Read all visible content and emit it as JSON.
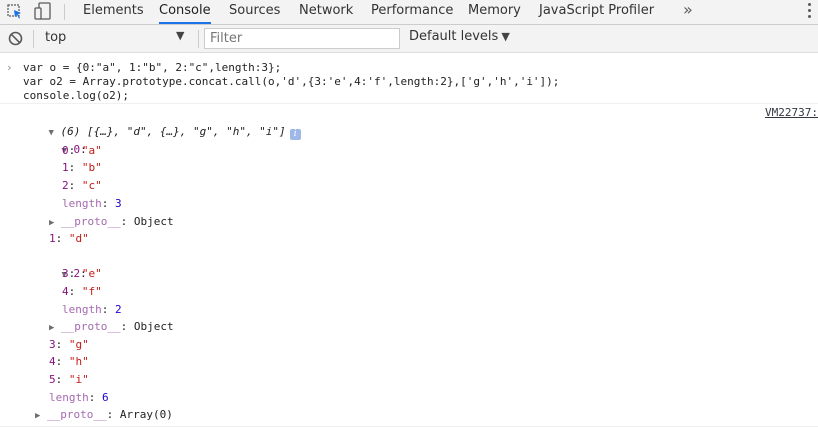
{
  "tabs": [
    {
      "label": "Elements"
    },
    {
      "label": "Console"
    },
    {
      "label": "Sources"
    },
    {
      "label": "Network"
    },
    {
      "label": "Performance"
    },
    {
      "label": "Memory"
    },
    {
      "label": "JavaScript Profiler"
    }
  ],
  "tab_more": "»",
  "toolbar": {
    "context": "top",
    "filter_placeholder": "Filter",
    "levels": "Default levels"
  },
  "input_code": [
    "var o = {0:\"a\", 1:\"b\", 2:\"c\",length:3};",
    "var o2 = Array.prototype.concat.call(o,'d',{3:'e',4:'f',length:2},['g','h','i']);",
    "console.log(o2);"
  ],
  "output": {
    "source": "VM22737:",
    "summary_count": "(6)",
    "summary": "[{…}, \"d\", {…}, \"g\", \"h\", \"i\"]",
    "info_badge": "i",
    "rows": [
      {
        "key": "0",
        "value": ""
      },
      {
        "key": "0",
        "value": "\"a\""
      },
      {
        "key": "1",
        "value": "\"b\""
      },
      {
        "key": "2",
        "value": "\"c\""
      },
      {
        "key": "length",
        "value": "3"
      },
      {
        "key": "__proto__",
        "value": "Object"
      },
      {
        "key": "1",
        "value": "\"d\""
      },
      {
        "key": "2",
        "value": ""
      },
      {
        "key": "3",
        "value": "\"e\""
      },
      {
        "key": "4",
        "value": "\"f\""
      },
      {
        "key": "length",
        "value": "2"
      },
      {
        "key": "__proto__",
        "value": "Object"
      },
      {
        "key": "3",
        "value": "\"g\""
      },
      {
        "key": "4",
        "value": "\"h\""
      },
      {
        "key": "5",
        "value": "\"i\""
      },
      {
        "key": "length",
        "value": "6"
      },
      {
        "key": "__proto__",
        "value": "Array(0)"
      }
    ]
  },
  "colors": {
    "accent": "#1a73e8",
    "string": "#c41a16",
    "number": "#1c00cf",
    "key": "#881280"
  }
}
